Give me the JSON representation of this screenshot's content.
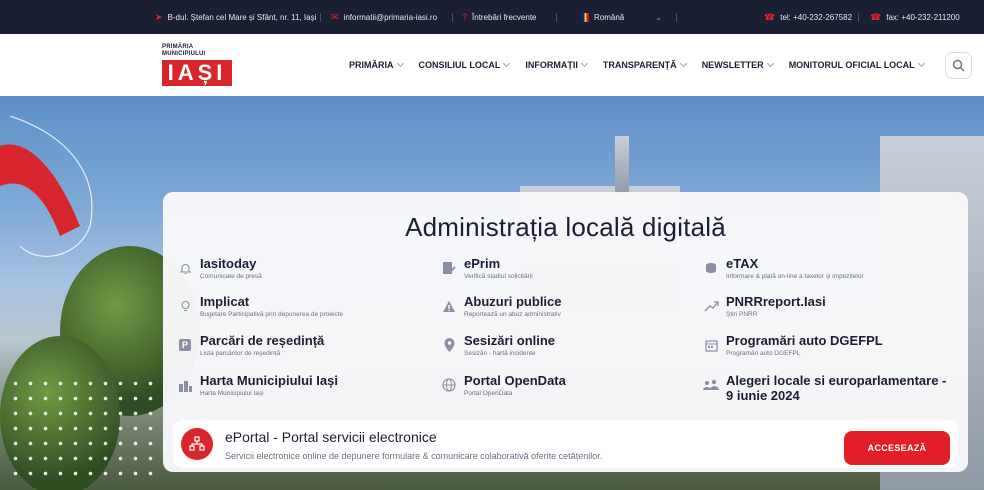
{
  "topbar": {
    "address": "B-dul. Ștefan cel Mare și Sfânt, nr. 11, Iași",
    "email": "informatii@primaria-iasi.ro",
    "faq": "Întrebări frecvente",
    "language": "Română",
    "tel": "tel: +40-232-267582",
    "fax": "fax: +40-232-211200"
  },
  "header": {
    "logo_line1": "PRIMĂRIA",
    "logo_line2": "MUNICIPIULUI",
    "logo_text": "IAȘI",
    "nav": [
      "PRIMĂRIA",
      "CONSILIUL LOCAL",
      "INFORMAȚII",
      "TRANSPARENȚĂ",
      "NEWSLETTER",
      "MONITORUL OFICIAL LOCAL"
    ]
  },
  "card": {
    "title": "Administrația locală digitală",
    "services": [
      {
        "title": "Iasitoday",
        "sub": "Comunicate de presă",
        "icon": "bell-icon"
      },
      {
        "title": "ePrim",
        "sub": "Verifică stadiul solicitării",
        "icon": "document-icon"
      },
      {
        "title": "eTAX",
        "sub": "Informare & plată on-line a taxelor și impozitelor",
        "icon": "coins-icon"
      },
      {
        "title": "Implicat",
        "sub": "Bugetare Participativă prin depunerea de proiecte",
        "icon": "lightbulb-icon"
      },
      {
        "title": "Abuzuri publice",
        "sub": "Reportează un abuz administrativ",
        "icon": "warning-icon"
      },
      {
        "title": "PNRRreport.Iasi",
        "sub": "Știri PNRR",
        "icon": "trend-icon"
      },
      {
        "title": "Parcări de reședință",
        "sub": "Lista parcărilor de reședință",
        "icon": "parking-icon"
      },
      {
        "title": "Sesizări online",
        "sub": "Sesizări - hartă incidente",
        "icon": "map-pin-icon"
      },
      {
        "title": "Programări auto DGEFPL",
        "sub": "Programări auto DGEFPL",
        "icon": "calendar-icon"
      },
      {
        "title": "Harta Municipiului Iași",
        "sub": "Harta Municipiului Iași",
        "icon": "city-icon"
      },
      {
        "title": "Portal OpenData",
        "sub": "Portal OpenData",
        "icon": "globe-icon"
      },
      {
        "title": "Alegeri locale si europarlamentare - 9 iunie 2024",
        "sub": "",
        "icon": "people-icon"
      }
    ]
  },
  "portal": {
    "title": "ePortal - Portal servicii electronice",
    "subtitle": "Servicii electronice online de depunere formulare & comunicare colaborativă oferite cetățenilor.",
    "button": "ACCESEAZĂ"
  },
  "colors": {
    "accent": "#e21f26",
    "topbar": "#1b1f33"
  }
}
